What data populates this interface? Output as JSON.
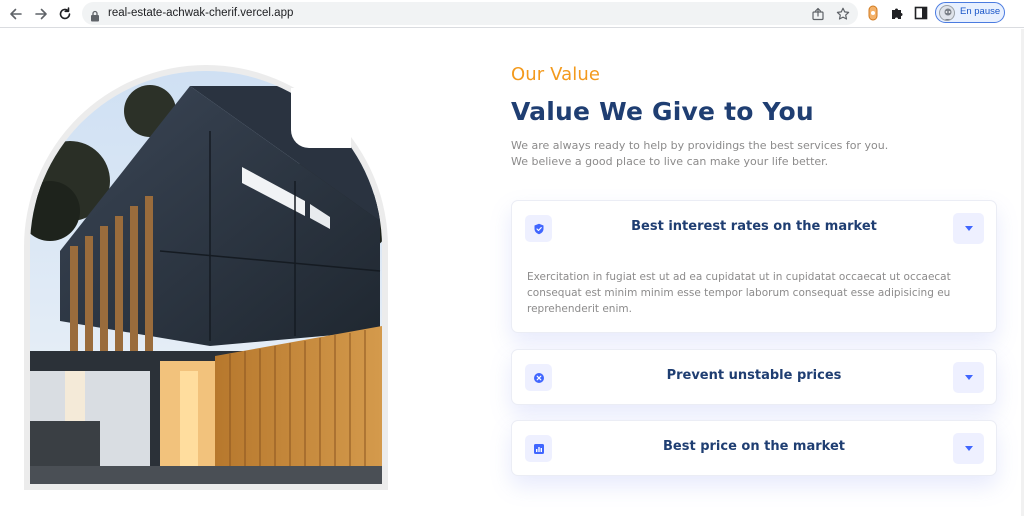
{
  "browser": {
    "url": "real-estate-achwak-cherif.vercel.app",
    "profile_status": "En pause"
  },
  "value_section": {
    "eyebrow": "Our Value",
    "heading": "Value We Give to You",
    "description_lines": [
      "We are always ready to help by providings the best services for you.",
      "We believe a good place to live can make your life better."
    ],
    "accordion": [
      {
        "icon": "shield-check-icon",
        "title": "Best interest rates on the market",
        "expanded": true,
        "body": "Exercitation in fugiat est ut ad ea cupidatat ut in cupidatat occaecat ut occaecat consequat est minim minim esse tempor laborum consequat esse adipisicing eu reprehenderit enim."
      },
      {
        "icon": "x-circle-icon",
        "title": "Prevent unstable prices",
        "expanded": false
      },
      {
        "icon": "chart-bar-icon",
        "title": "Best price on the market",
        "expanded": false
      }
    ]
  },
  "colors": {
    "accent_orange": "#f39a1d",
    "heading_navy": "#1f3e72",
    "icon_blue": "#4066ff",
    "icon_bg": "#eef0ff",
    "text_gray": "#8c8b8b"
  }
}
